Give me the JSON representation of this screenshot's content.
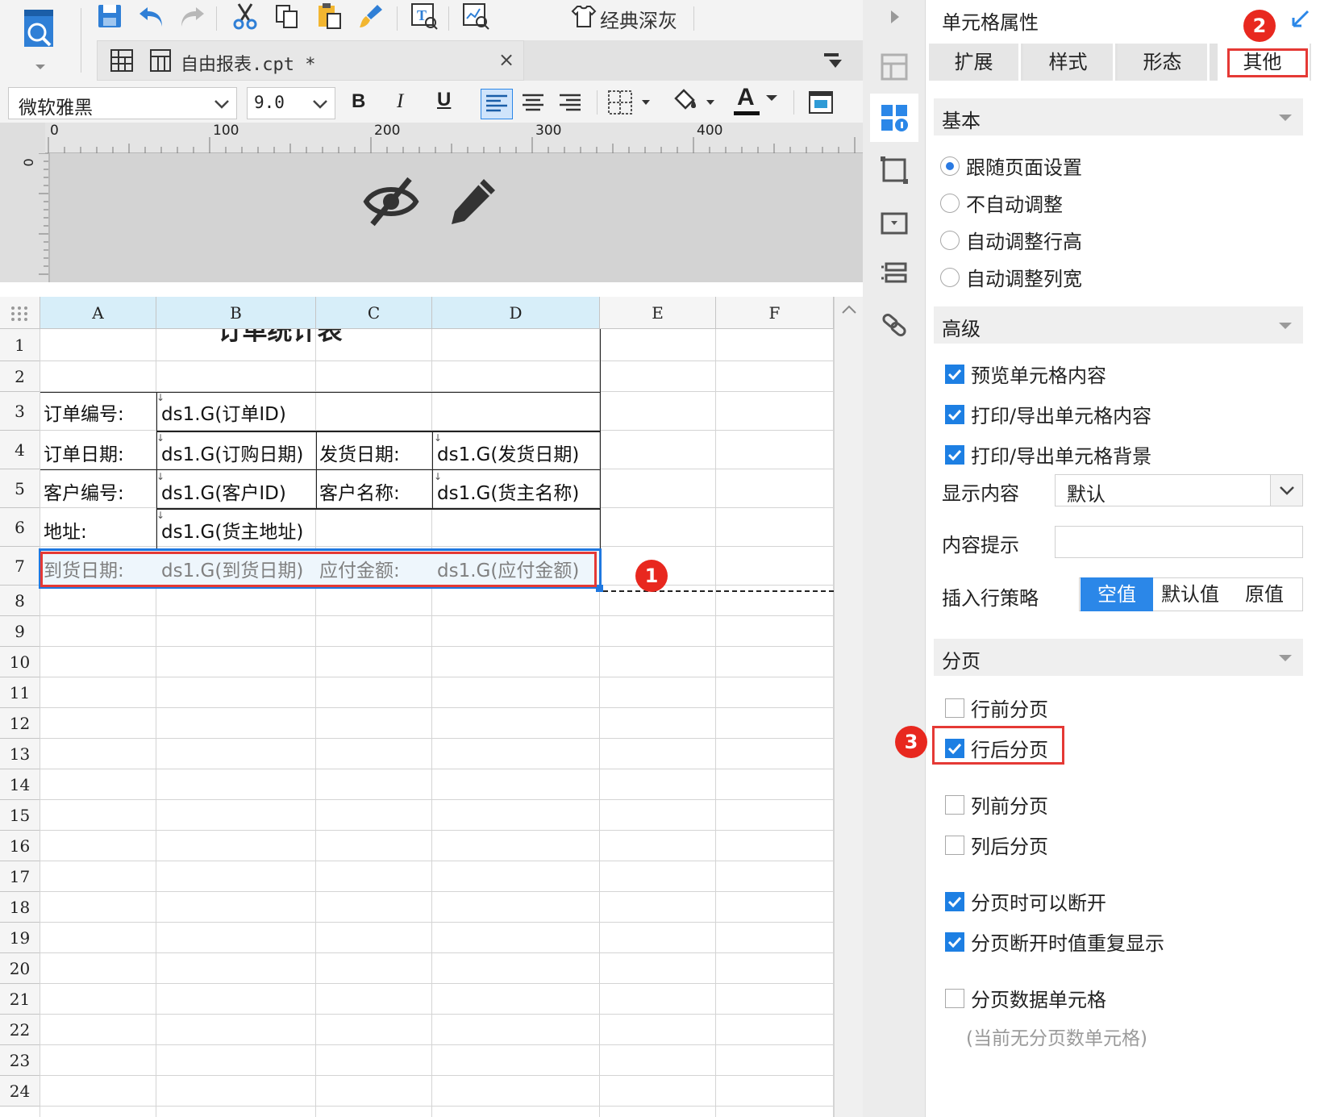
{
  "toolbar": {
    "theme_label": "经典深灰",
    "file_tab": "自由报表.cpt *",
    "close_glyph": "×",
    "font_name": "微软雅黑",
    "font_size": "9.0",
    "bold": "B",
    "italic": "I",
    "underline": "U",
    "font_color": "A"
  },
  "ruler": {
    "ticks": [
      "0",
      "100",
      "200",
      "300",
      "400"
    ],
    "left_tick": "0"
  },
  "grid": {
    "columns": [
      "A",
      "B",
      "C",
      "D",
      "E",
      "F"
    ],
    "rows": [
      "1",
      "2",
      "3",
      "4",
      "5",
      "6",
      "7",
      "8",
      "9",
      "10",
      "11",
      "12",
      "13",
      "14",
      "15",
      "16",
      "17",
      "18",
      "19",
      "20",
      "21",
      "22",
      "23",
      "24"
    ],
    "title": "订单统计表",
    "cells": {
      "a3": "订单编号:",
      "b3": "ds1.G(订单ID)",
      "a4": "订单日期:",
      "b4": "ds1.G(订购日期)",
      "c4": "发货日期:",
      "d4": "ds1.G(发货日期)",
      "a5": "客户编号:",
      "b5": "ds1.G(客户ID)",
      "c5": "客户名称:",
      "d5": "ds1.G(货主名称)",
      "a6": "地址:",
      "b6": "ds1.G(货主地址)",
      "a7": "到货日期:",
      "b7": "ds1.G(到货日期)",
      "c7": "应付金额:",
      "d7": "ds1.G(应付金额)"
    }
  },
  "panel": {
    "title": "单元格属性",
    "tabs": [
      "扩展",
      "样式",
      "形态",
      "其他"
    ],
    "active_tab": "其他",
    "sections": {
      "basic": "基本",
      "advanced": "高级",
      "paging": "分页"
    },
    "basic_options": [
      "跟随页面设置",
      "不自动调整",
      "自动调整行高",
      "自动调整列宽"
    ],
    "advanced_checks": [
      "预览单元格内容",
      "打印/导出单元格内容",
      "打印/导出单元格背景"
    ],
    "display_label": "显示内容",
    "display_value": "默认",
    "hint_label": "内容提示",
    "hint_value": "",
    "strategy_label": "插入行策略",
    "strategy_options": [
      "空值",
      "默认值",
      "原值"
    ],
    "paging_checks": {
      "before_row": "行前分页",
      "after_row": "行后分页",
      "before_col": "列前分页",
      "after_col": "列后分页",
      "breakable": "分页时可以断开",
      "repeat": "分页断开时值重复显示",
      "data_cell": "分页数据单元格"
    },
    "no_page_cell": "(当前无分页数单元格)"
  },
  "annotations": [
    "1",
    "2",
    "3"
  ],
  "colors": {
    "accent": "#2b87e8",
    "annotation_red": "#e53935",
    "selected_col": "#d7eef9"
  }
}
